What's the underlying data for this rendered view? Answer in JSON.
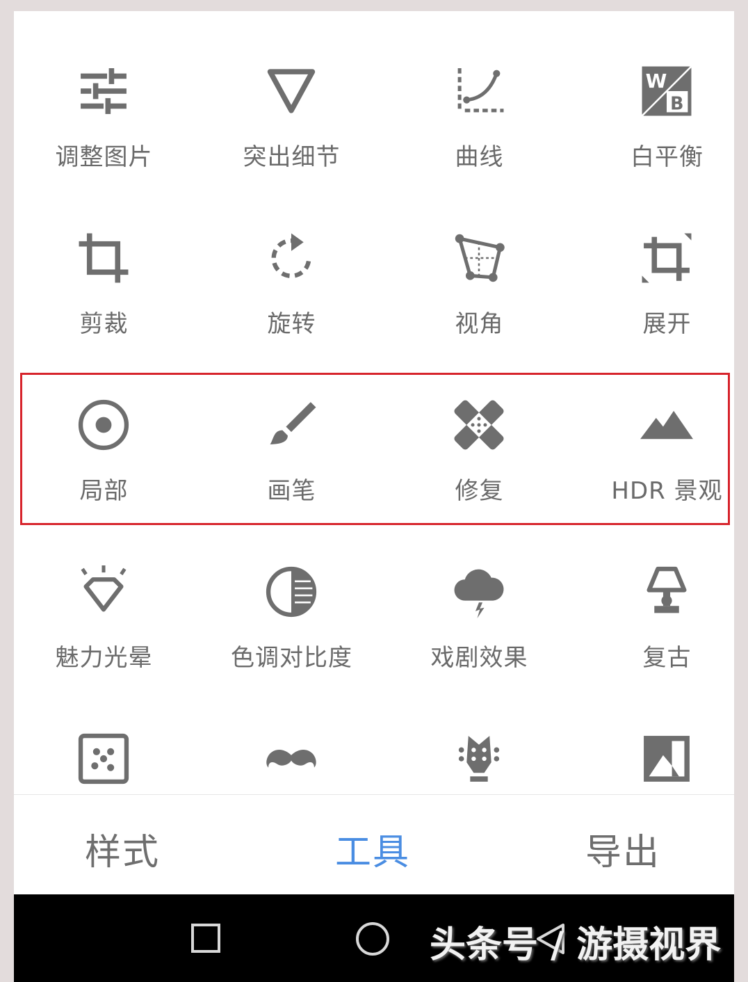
{
  "tools": [
    {
      "label": "调整图片",
      "icon": "tune-sliders-icon"
    },
    {
      "label": "突出细节",
      "icon": "triangle-details-icon"
    },
    {
      "label": "曲线",
      "icon": "curves-icon"
    },
    {
      "label": "白平衡",
      "icon": "white-balance-icon"
    },
    {
      "label": "剪裁",
      "icon": "crop-icon"
    },
    {
      "label": "旋转",
      "icon": "rotate-icon"
    },
    {
      "label": "视角",
      "icon": "perspective-icon"
    },
    {
      "label": "展开",
      "icon": "expand-icon"
    },
    {
      "label": "局部",
      "icon": "selective-icon"
    },
    {
      "label": "画笔",
      "icon": "brush-icon"
    },
    {
      "label": "修复",
      "icon": "healing-icon"
    },
    {
      "label": "HDR 景观",
      "icon": "hdr-scape-icon"
    },
    {
      "label": "魅力光晕",
      "icon": "glamour-glow-icon"
    },
    {
      "label": "色调对比度",
      "icon": "tonal-contrast-icon"
    },
    {
      "label": "戏剧效果",
      "icon": "drama-icon"
    },
    {
      "label": "复古",
      "icon": "vintage-lamp-icon"
    },
    {
      "label": "",
      "icon": "grainy-film-icon"
    },
    {
      "label": "",
      "icon": "retrolux-mustache-icon"
    },
    {
      "label": "",
      "icon": "grunge-guitar-icon"
    },
    {
      "label": "",
      "icon": "black-white-icon"
    }
  ],
  "tabs": [
    {
      "label": "样式",
      "active": false
    },
    {
      "label": "工具",
      "active": true
    },
    {
      "label": "导出",
      "active": false
    }
  ],
  "navbar": {
    "buttons": [
      "recent-apps-icon",
      "home-icon",
      "back-icon"
    ],
    "watermark": "头条号 / 游摄视界"
  },
  "colors": {
    "icon": "#6e6e6e",
    "label": "#6a6a6a",
    "active_tab": "#4a8de2",
    "highlight_border": "#d7242c"
  }
}
